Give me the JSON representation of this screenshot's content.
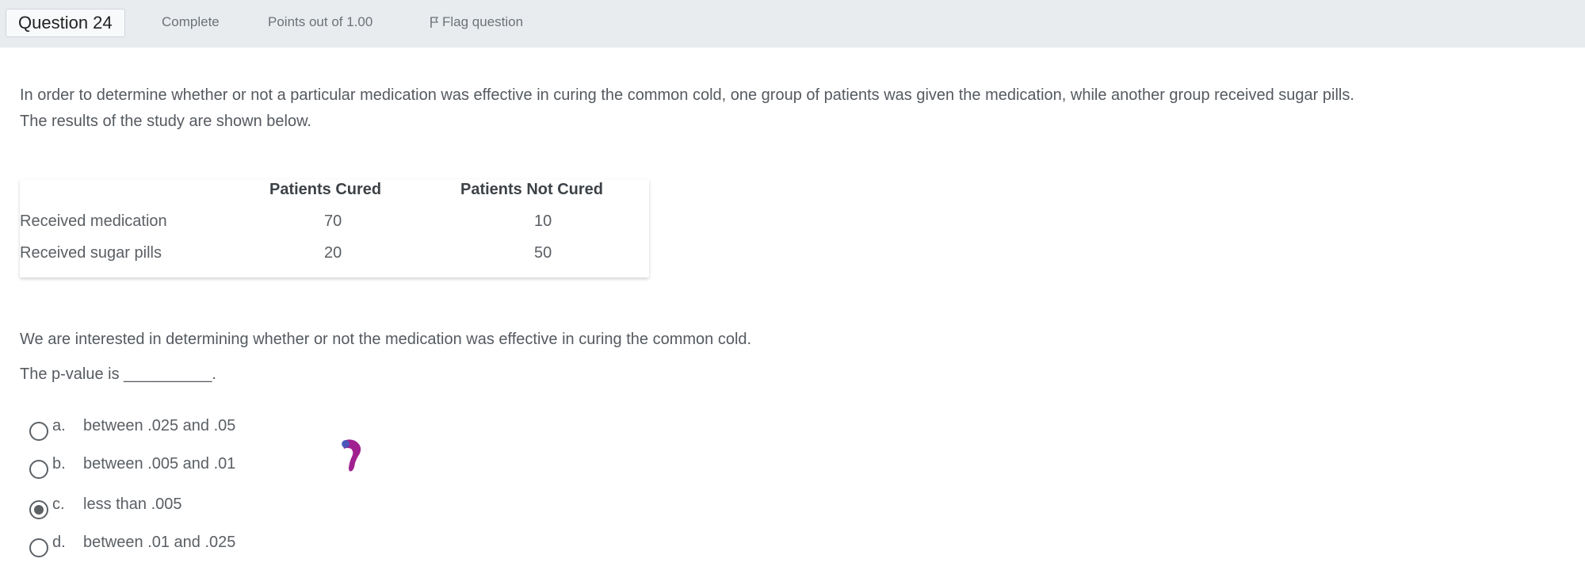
{
  "header": {
    "question_label": "Question 24",
    "status": "Complete",
    "points": "Points out of 1.00",
    "flag": "Flag question"
  },
  "question": {
    "intro_line1": "In order to determine whether or not a particular medication was effective in curing the common cold, one group of patients was given the medication, while another group received sugar pills.",
    "intro_line2": "The results of the study are shown below.",
    "prompt": "We are interested in determining whether or not the medication was effective in curing the common cold.",
    "blank_line": "The p-value is __________."
  },
  "table": {
    "headers": [
      "",
      "Patients Cured",
      "Patients Not Cured"
    ],
    "rows": [
      [
        "Received medication",
        "70",
        "10"
      ],
      [
        "Received sugar pills",
        "20",
        "50"
      ]
    ]
  },
  "options": [
    {
      "letter": "a.",
      "text": "between .025 and .05",
      "checked": false
    },
    {
      "letter": "b.",
      "text": "between .005 and .01",
      "checked": false
    },
    {
      "letter": "c.",
      "text": "less than .005",
      "checked": true
    },
    {
      "letter": "d.",
      "text": "between .01 and .025",
      "checked": false
    }
  ],
  "icons": {
    "flag": "flag-icon",
    "cursor": "cursor-icon"
  },
  "colors": {
    "header_bg": "#e9ecef",
    "text": "#555a60",
    "cursor_purple": "#a0208f",
    "cursor_blue": "#3b5fc0"
  }
}
